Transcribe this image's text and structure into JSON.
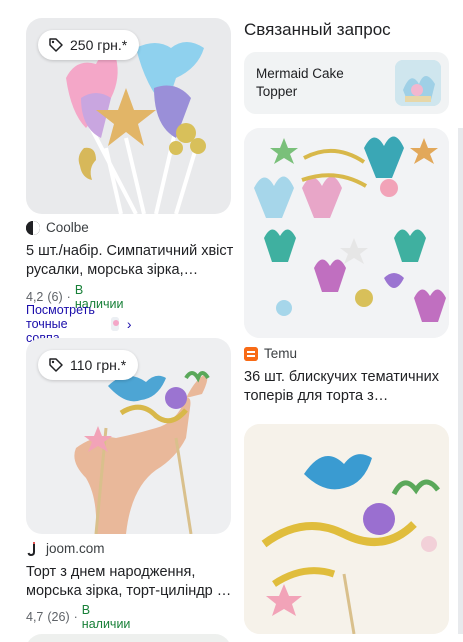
{
  "left_col": {
    "items": [
      {
        "price": "250 грн.*",
        "source": "Coolbe",
        "title_line1": "5 шт./набір. Симпатичний хвіст",
        "title_line2": "русалки, морська зірка,…",
        "rating": "4,2",
        "reviews": "(6)",
        "stock": "В наличии",
        "visual_link": "Посмотреть точные совпа…"
      },
      {
        "price": "110 грн.*",
        "source": "joom.com",
        "title_line1": "Торт з днем народження,",
        "title_line2": "морська зірка, торт-циліндр …",
        "rating": "4,7",
        "reviews": "(26)",
        "stock": "В наличии"
      }
    ]
  },
  "right_col": {
    "related_heading": "Связанный запрос",
    "related_label": "Mermaid Cake Topper",
    "items": [
      {
        "source": "Temu",
        "title_line1": "36 шт. блискучих тематичних",
        "title_line2": "топерів для торта з…"
      }
    ]
  },
  "separator_dot": "·",
  "chevron": "›",
  "colors": {
    "accent_link": "#1a0dab",
    "stock_green": "#188038",
    "temu_orange": "#f86b16"
  },
  "icons": [
    "price-tag-icon",
    "coolbe-favicon",
    "joom-favicon",
    "temu-favicon",
    "chevron-right-icon"
  ]
}
